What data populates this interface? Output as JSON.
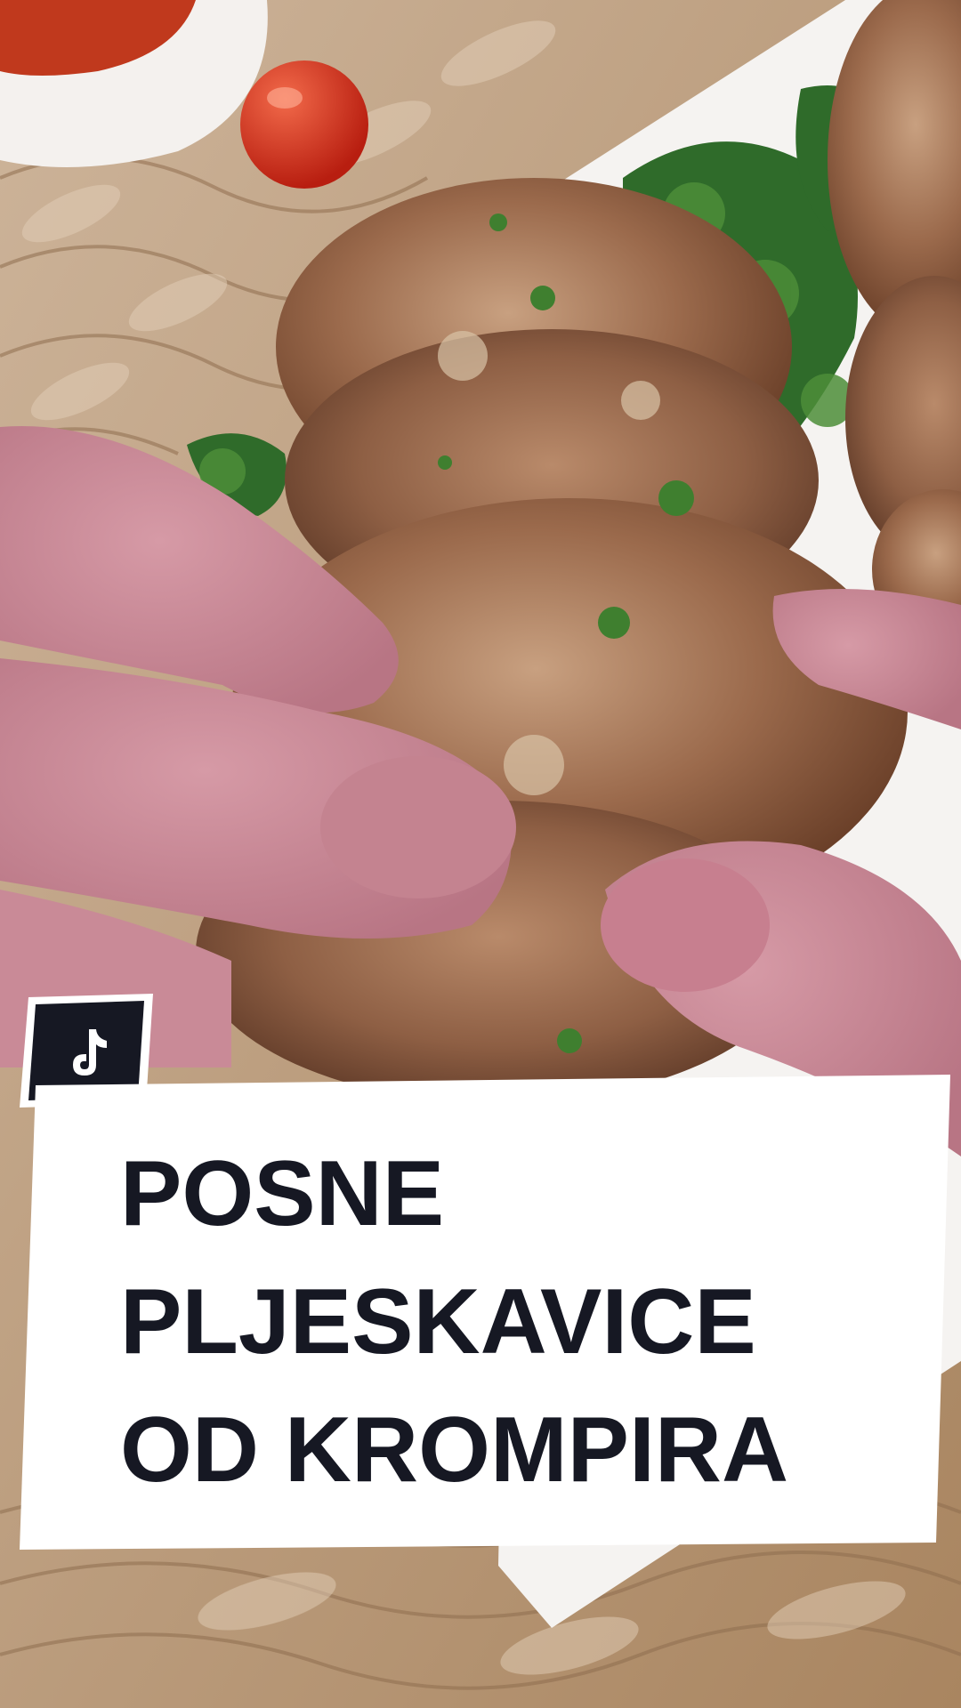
{
  "title": {
    "lines": [
      "POSNE",
      "PLJESKAVICE",
      "OD KROMPIRA"
    ]
  },
  "badge": {
    "icon": "tiktok-logo-icon"
  },
  "colors": {
    "card_background": "#ffffff",
    "title_text": "#161823",
    "badge_background": "#161823",
    "badge_border": "#ffffff"
  }
}
